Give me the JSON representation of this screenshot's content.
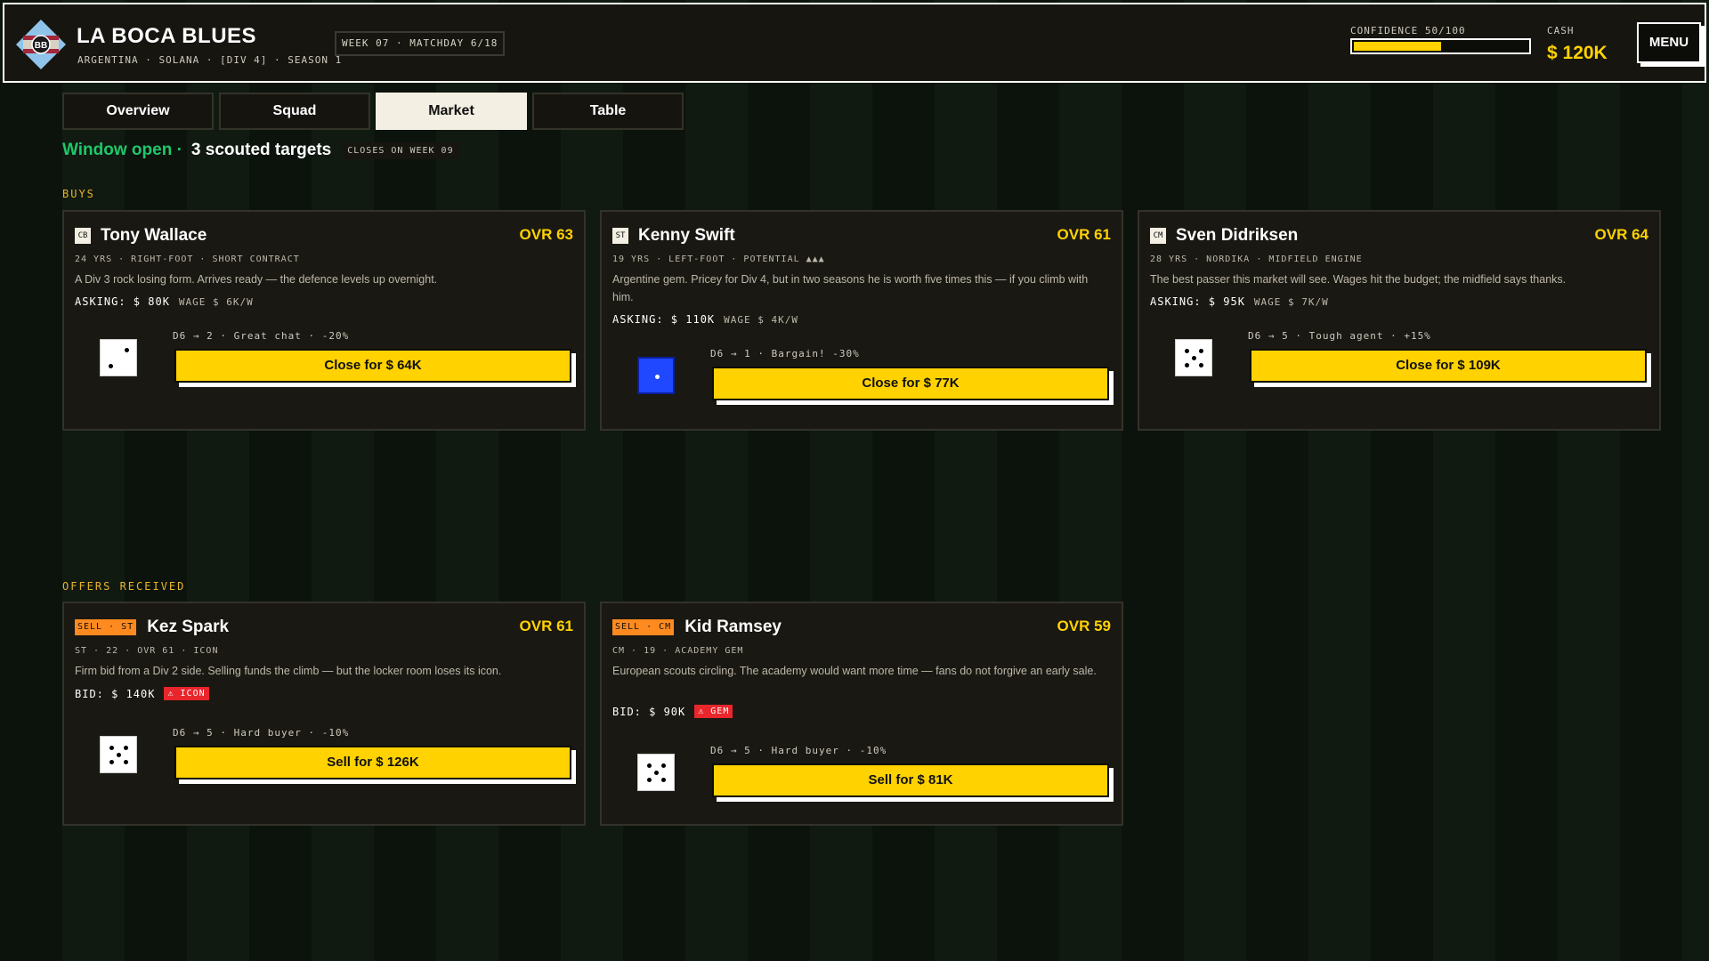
{
  "header": {
    "crest_text": "BB",
    "club_name": "LA BOCA BLUES",
    "club_sub": "ARGENTINA · SOLANA · [DIV 4] · SEASON 1",
    "week": "WEEK 07 · MATCHDAY 6/18",
    "confidence_label": "CONFIDENCE 50/100",
    "confidence_value": 50,
    "cash_label": "CASH",
    "cash_value": "$ 120K",
    "menu_label": "MENU"
  },
  "tabs": [
    {
      "label": "Overview",
      "active": false
    },
    {
      "label": "Squad",
      "active": false
    },
    {
      "label": "Market",
      "active": true
    },
    {
      "label": "Table",
      "active": false
    }
  ],
  "status": {
    "open": "Window open ·",
    "count": "3 scouted targets",
    "closes": "CLOSES ON WEEK 09"
  },
  "buys_label": "BUYS",
  "offers_label": "OFFERS RECEIVED",
  "buys": [
    {
      "pos": "CB",
      "name": "Tony Wallace",
      "ovr": "OVR 63",
      "meta": "24 YRS · RIGHT-FOOT · SHORT CONTRACT",
      "desc": "A Div 3 rock losing form. Arrives ready — the defence levels up overnight.",
      "asking": "ASKING: $ 80K",
      "wage": "WAGE $ 6K/W",
      "die_value": 2,
      "die_color": "white",
      "roll": "D6 → 2 · Great chat · -20%",
      "button": "Close for $ 64K"
    },
    {
      "pos": "ST",
      "name": "Kenny Swift",
      "ovr": "OVR 61",
      "meta": "19 YRS · LEFT-FOOT · POTENTIAL ▲▲▲",
      "desc": "Argentine gem. Pricey for Div 4, but in two seasons he is worth five times this — if you climb with him.",
      "asking": "ASKING: $ 110K",
      "wage": "WAGE $ 4K/W",
      "die_value": 1,
      "die_color": "blue",
      "roll": "D6 → 1 · Bargain! -30%",
      "button": "Close for $ 77K"
    },
    {
      "pos": "CM",
      "name": "Sven Didriksen",
      "ovr": "OVR 64",
      "meta": "28 YRS · NORDIKA · MIDFIELD ENGINE",
      "desc": "The best passer this market will see. Wages hit the budget; the midfield says thanks.",
      "asking": "ASKING: $ 95K",
      "wage": "WAGE $ 7K/W",
      "die_value": 5,
      "die_color": "white",
      "roll": "D6 → 5 · Tough agent · +15%",
      "button": "Close for $ 109K"
    }
  ],
  "offers": [
    {
      "badge": "SELL · ST",
      "name": "Kez Spark",
      "ovr": "OVR 61",
      "meta": "ST · 22 · OVR 61 · ICON",
      "desc": "Firm bid from a Div 2 side. Selling funds the climb — but the locker room loses its icon.",
      "bid": "BID: $ 140K",
      "warn": "⚠ ICON",
      "die_value": 5,
      "die_color": "white",
      "roll": "D6 → 5 · Hard buyer · -10%",
      "button": "Sell for $ 126K"
    },
    {
      "badge": "SELL · CM",
      "name": "Kid Ramsey",
      "ovr": "OVR 59",
      "meta": "CM · 19 · ACADEMY GEM",
      "desc": "European scouts circling. The academy would want more time — fans do not forgive an early sale.",
      "bid": "BID: $ 90K",
      "warn": "⚠ GEM",
      "die_value": 5,
      "die_color": "white",
      "roll": "D6 → 5 · Hard buyer · -10%",
      "button": "Sell for $ 81K"
    }
  ]
}
